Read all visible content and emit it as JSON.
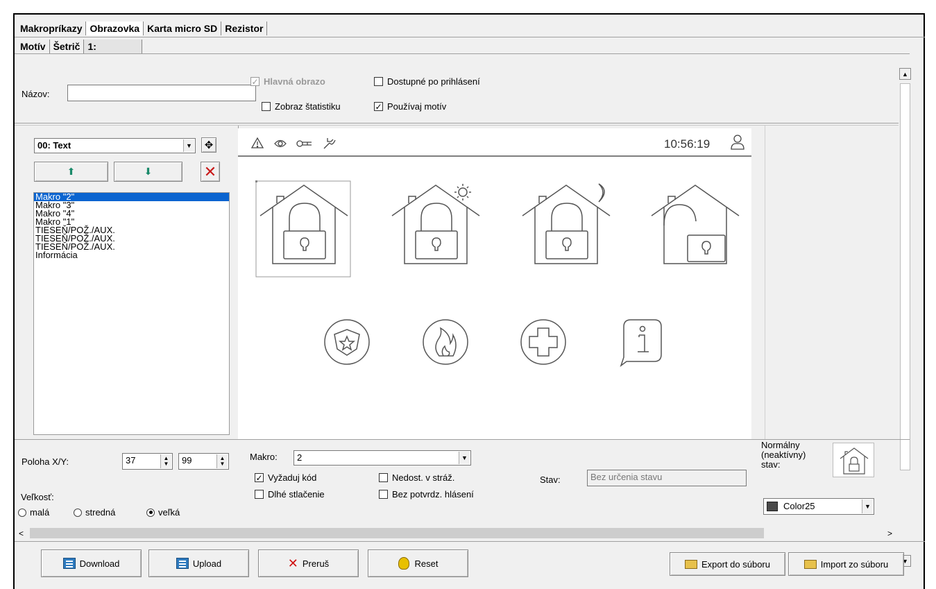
{
  "main_tabs": [
    "Makropríkazy",
    "Obrazovka",
    "Karta micro SD",
    "Rezistor"
  ],
  "sub_tabs": [
    "Motív",
    "Šetrič",
    "1:"
  ],
  "name_field": {
    "label": "Názov:",
    "value": ""
  },
  "options": {
    "main_screen": {
      "label": "Hlavná obrazo",
      "checked": true,
      "disabled": true
    },
    "available_after_login": {
      "label": "Dostupné po prihlásení",
      "checked": false
    },
    "show_statistics": {
      "label": "Zobraz štatistiku",
      "checked": false
    },
    "use_theme": {
      "label": "Používaj motív",
      "checked": true
    }
  },
  "element_dropdown": {
    "value": "00: Text"
  },
  "macro_list": [
    "Makro \"2\"",
    "Makro \"3\"",
    "Makro \"4\"",
    "Makro \"1\"",
    "TIESEŇ/POŽ./AUX.",
    "TIESEŇ/POŽ./AUX.",
    "TIESEŇ/POŽ./AUX.",
    "Informácia"
  ],
  "macro_list_selected": 0,
  "preview": {
    "status_icons": [
      "warning-icon",
      "eye-icon",
      "key-icon",
      "wrench-icon"
    ],
    "time": "10:56:19",
    "tiles_row1": [
      "house-lock-icon",
      "house-lock-sun-icon",
      "house-lock-moon-icon",
      "house-unlock-icon"
    ],
    "tiles_row2": [
      "police-badge-icon",
      "fire-icon",
      "medical-cross-icon",
      "info-icon"
    ]
  },
  "position": {
    "label": "Poloha X/Y:",
    "x": "37",
    "y": "99"
  },
  "size": {
    "label": "Veľkosť:",
    "options": [
      "malá",
      "stredná",
      "veľká"
    ],
    "selected": "veľká"
  },
  "macro": {
    "label": "Makro:",
    "value": "2"
  },
  "flags": {
    "require_code": {
      "label": "Vyžaduj kód",
      "checked": true
    },
    "not_available_armed": {
      "label": "Nedost. v stráž.",
      "checked": false
    },
    "long_press": {
      "label": "Dlhé stlačenie",
      "checked": false
    },
    "no_confirm": {
      "label": "Bez potvrdz. hlásení",
      "checked": false
    }
  },
  "state": {
    "label": "Stav:",
    "value": "Bez určenia stavu"
  },
  "normal_state": {
    "label_lines": [
      "Normálny",
      "(neaktívny)",
      "stav:"
    ],
    "color": "Color25"
  },
  "buttons": {
    "download": "Download",
    "upload": "Upload",
    "abort": "Preruš",
    "reset": "Reset",
    "export": "Export do súboru",
    "import": "Import zo súboru"
  },
  "colors": {
    "selection": "#0a64d0",
    "abort_x": "#d01010",
    "delete_x": "#c81818",
    "arrows": "#1a8a6a"
  }
}
